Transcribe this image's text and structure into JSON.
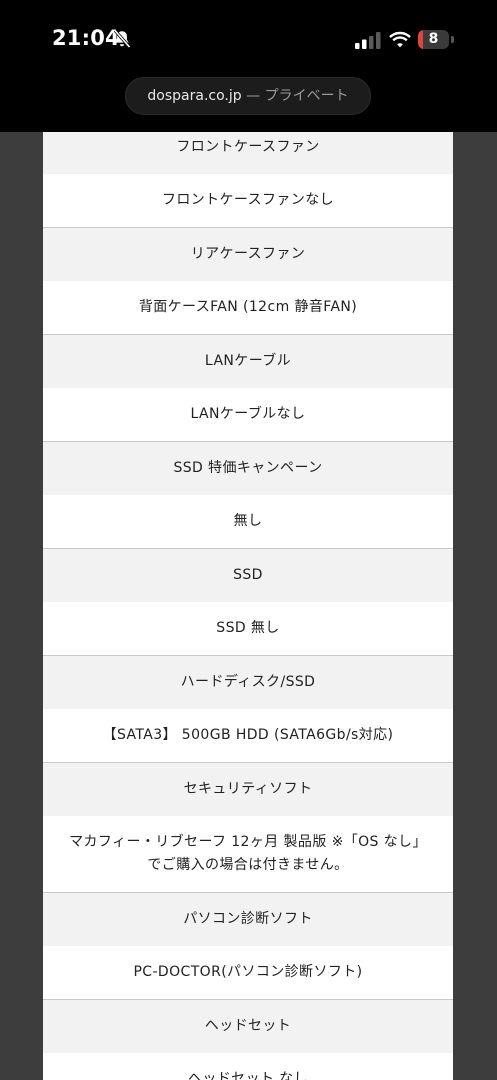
{
  "status_bar": {
    "time": "21:04",
    "battery_level": "8",
    "icons": [
      "bell-slash-icon",
      "cellular-signal-icon",
      "wifi-icon",
      "battery-icon"
    ],
    "battery_fill_percent": 8,
    "battery_fill_color": "#e0453a"
  },
  "url_bar": {
    "domain": "dospara.co.jp",
    "separator": " — ",
    "mode": "プライベート"
  },
  "spec_list": {
    "rows": [
      {
        "text": "フロントケースファン",
        "kind": "heading"
      },
      {
        "text": "フロントケースファンなし",
        "kind": "value"
      },
      {
        "text": "リアケースファン",
        "kind": "heading"
      },
      {
        "text": "背面ケースFAN (12cm 静音FAN)",
        "kind": "value"
      },
      {
        "text": "LANケーブル",
        "kind": "heading"
      },
      {
        "text": "LANケーブルなし",
        "kind": "value"
      },
      {
        "text": "SSD 特価キャンペーン",
        "kind": "heading"
      },
      {
        "text": "無し",
        "kind": "value"
      },
      {
        "text": "SSD",
        "kind": "heading"
      },
      {
        "text": "SSD 無し",
        "kind": "value"
      },
      {
        "text": "ハードディスク/SSD",
        "kind": "heading"
      },
      {
        "text": "【SATA3】 500GB HDD (SATA6Gb/s対応)",
        "kind": "value"
      },
      {
        "text": "セキュリティソフト",
        "kind": "heading"
      },
      {
        "text": "マカフィー・リブセーフ 12ヶ月 製品版 ※「OS なし」でご購入の場合は付きません。",
        "kind": "value"
      },
      {
        "text": "パソコン診断ソフト",
        "kind": "heading"
      },
      {
        "text": "PC-DOCTOR(パソコン診断ソフト)",
        "kind": "value"
      },
      {
        "text": "ヘッドセット",
        "kind": "heading"
      },
      {
        "text": "ヘッドセット なし",
        "kind": "value"
      }
    ]
  }
}
